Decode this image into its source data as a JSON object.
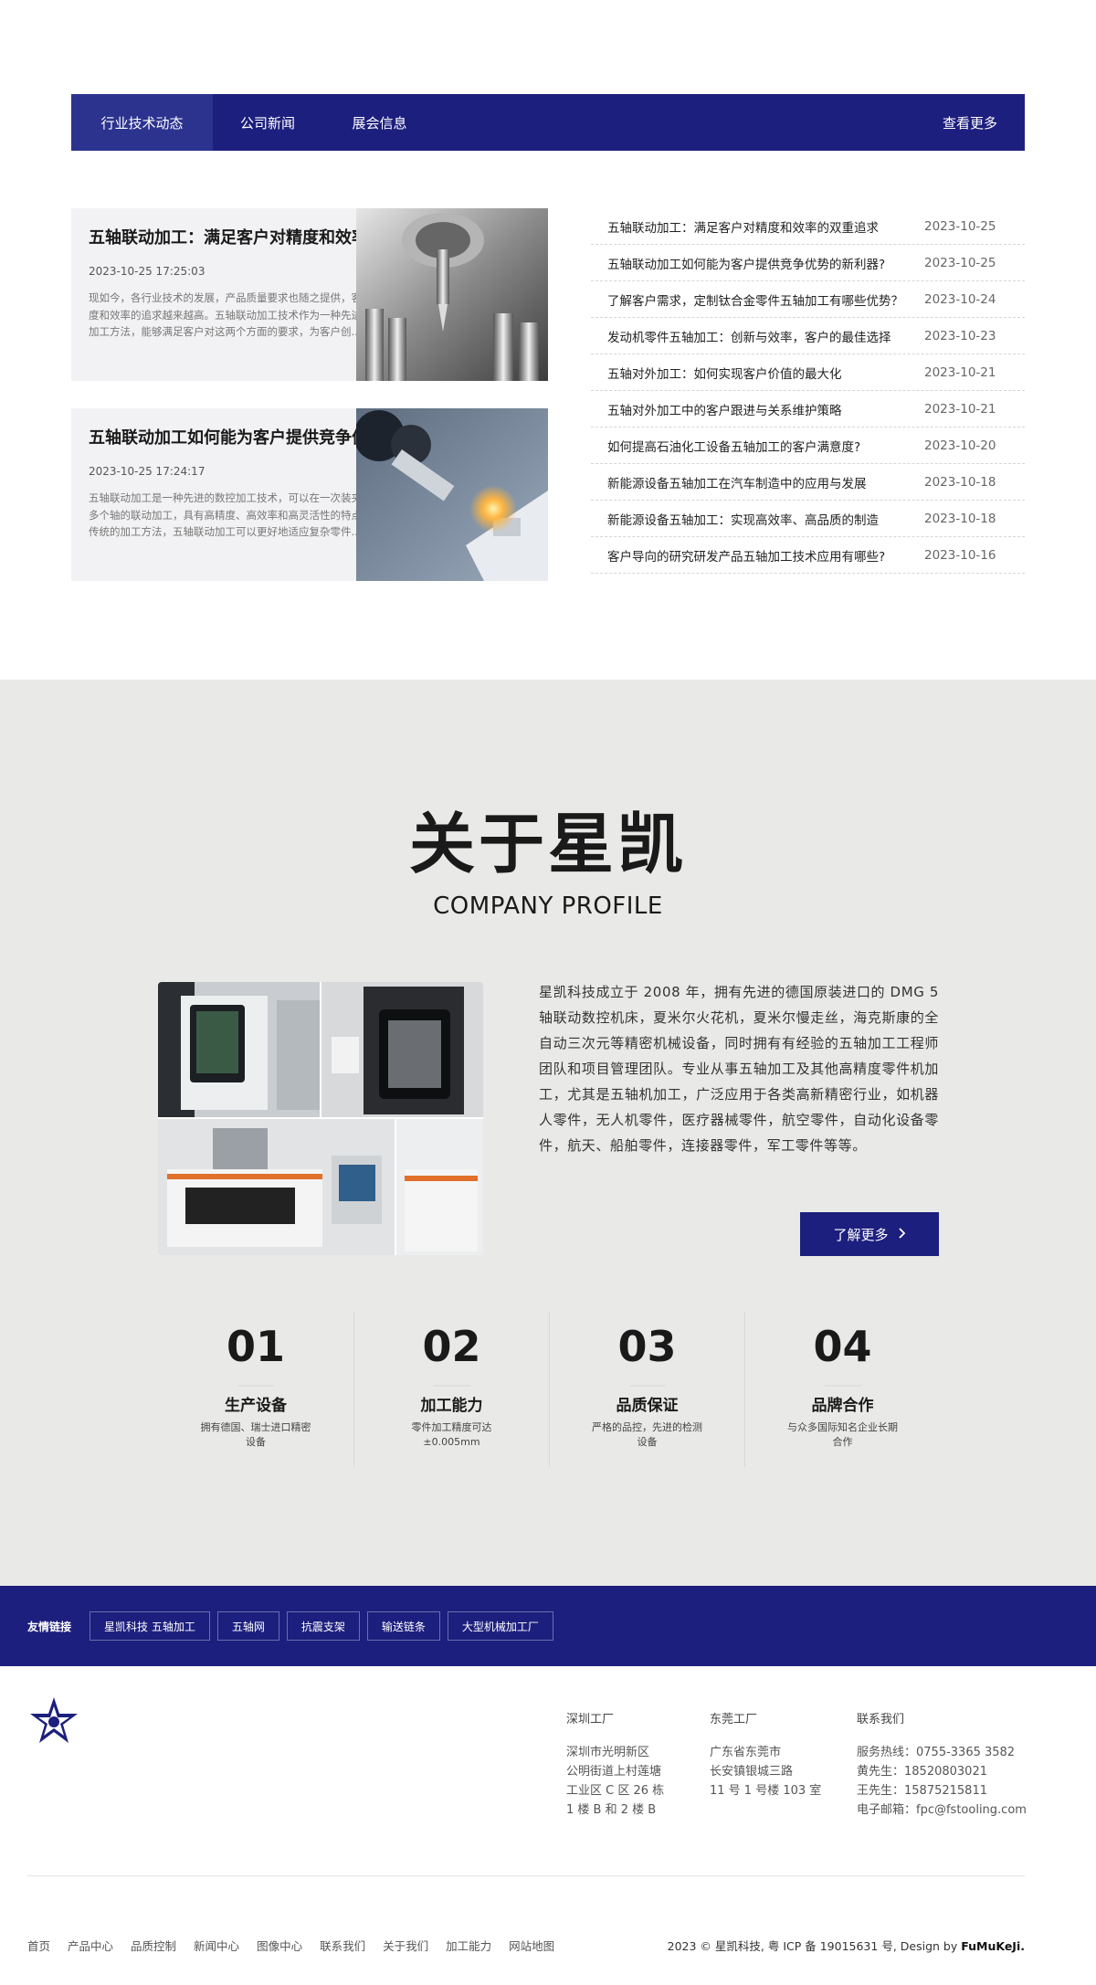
{
  "tabs": {
    "items": [
      "行业技术动态",
      "公司新闻",
      "展会信息"
    ],
    "more": "查看更多"
  },
  "featured": [
    {
      "title": "五轴联动加工：满足客户对精度和效率的双重追求",
      "time": "2023-10-25 17:25:03",
      "desc": "现如今，各行业技术的发展，产品质量要求也随之提供，客户对精度和效率的追求越来越高。五轴联动加工技术作为一种先进的数控加工方法，能够满足客户对这两个方面的要求，为客户创..."
    },
    {
      "title": "五轴联动加工如何能为客户提供竞争优势的新利器？",
      "time": "2023-10-25 17:24:17",
      "desc": "五轴联动加工是一种先进的数控加工技术，可以在一次装夹中实现多个轴的联动加工，具有高精度、高效率和高灵活性的特点。相比传统的加工方法，五轴联动加工可以更好地适应复杂零件..."
    }
  ],
  "news": [
    {
      "title": "五轴联动加工：满足客户对精度和效率的双重追求",
      "date": "2023-10-25"
    },
    {
      "title": "五轴联动加工如何能为客户提供竞争优势的新利器?",
      "date": "2023-10-25"
    },
    {
      "title": "了解客户需求，定制钛合金零件五轴加工有哪些优势？",
      "date": "2023-10-24"
    },
    {
      "title": "发动机零件五轴加工：创新与效率，客户的最佳选择",
      "date": "2023-10-23"
    },
    {
      "title": "五轴对外加工：如何实现客户价值的最大化",
      "date": "2023-10-21"
    },
    {
      "title": "五轴对外加工中的客户跟进与关系维护策略",
      "date": "2023-10-21"
    },
    {
      "title": "如何提高石油化工设备五轴加工的客户满意度?",
      "date": "2023-10-20"
    },
    {
      "title": "新能源设备五轴加工在汽车制造中的应用与发展",
      "date": "2023-10-18"
    },
    {
      "title": "新能源设备五轴加工：实现高效率、高品质的制造",
      "date": "2023-10-18"
    },
    {
      "title": "客户导向的研究研发产品五轴加工技术应用有哪些?",
      "date": "2023-10-16"
    }
  ],
  "about": {
    "title": "关于星凯",
    "subtitle": "COMPANY PROFILE",
    "text": "星凯科技成立于 2008 年，拥有先进的德国原装进口的 DMG 5 轴联动数控机床，夏米尔火花机，夏米尔慢走丝，海克斯康的全自动三次元等精密机械设备，同时拥有有经验的五轴加工工程师团队和项目管理团队。专业从事五轴加工及其他高精度零件机加工，尤其是五轴机加工，广泛应用于各类高新精密行业，如机器人零件，无人机零件，医疗器械零件，航空零件，自动化设备零件，航天、船舶零件，连接器零件，军工零件等等。",
    "button": "了解更多"
  },
  "stats": [
    {
      "num": "01",
      "label": "生产设备",
      "desc": "拥有德国、瑞士进口精密设备"
    },
    {
      "num": "02",
      "label": "加工能力",
      "desc": "零件加工精度可达±0.005mm"
    },
    {
      "num": "03",
      "label": "品质保证",
      "desc": "严格的品控，先进的检测设备"
    },
    {
      "num": "04",
      "label": "品牌合作",
      "desc": "与众多国际知名企业长期合作"
    }
  ],
  "friends": {
    "label": "友情链接",
    "links": [
      "星凯科技 五轴加工",
      "五轴网",
      "抗震支架",
      "输送链条",
      "大型机械加工厂"
    ]
  },
  "footer": {
    "col1": {
      "heading": "深圳工厂",
      "lines": [
        "深圳市光明新区",
        "公明街道上村莲塘",
        "工业区 C 区 26 栋",
        "1 楼 B 和 2 楼 B"
      ]
    },
    "col2": {
      "heading": "东莞工厂",
      "lines": [
        "广东省东莞市",
        "长安镇银城三路",
        "11 号 1 号楼 103 室"
      ]
    },
    "col3": {
      "heading": "联系我们",
      "lines": [
        "服务热线：0755-3365 3582",
        "黄先生：18520803021",
        "王先生：15875215811",
        "电子邮箱：fpc@fstooling.com"
      ]
    },
    "nav": [
      "首页",
      "产品中心",
      "品质控制",
      "新闻中心",
      "图像中心",
      "联系我们",
      "关于我们",
      "加工能力",
      "网站地图"
    ],
    "copyright": "2023 © 星凯科技, 粤 ICP 备 19015631 号, Design by ",
    "designer": "FuMuKeJi."
  },
  "colors": {
    "brand": "#1d1f7e",
    "about_bg": "#e9e9e7"
  }
}
